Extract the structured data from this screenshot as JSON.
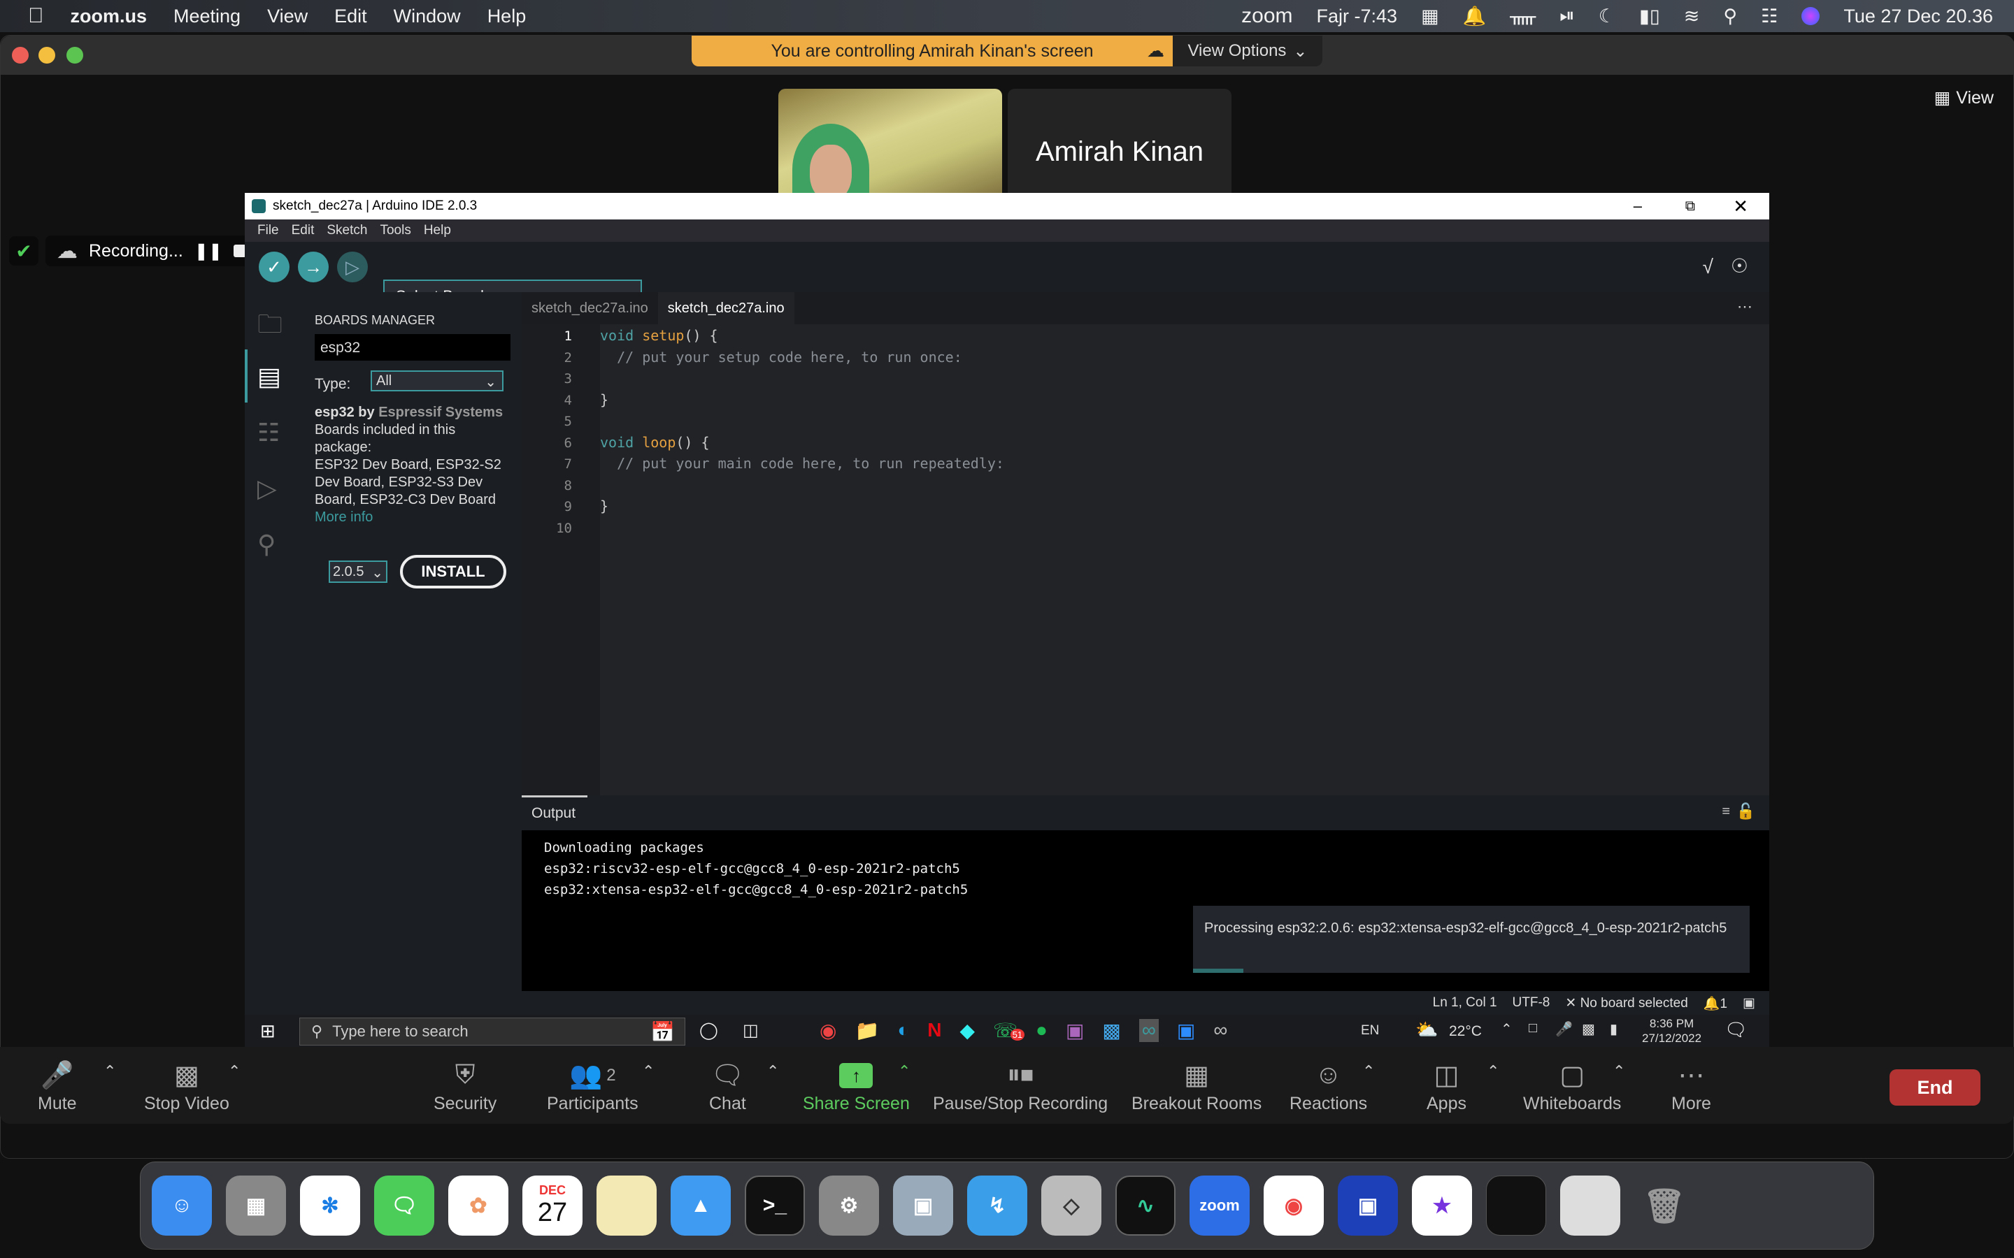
{
  "menubar": {
    "app": "zoom.us",
    "items": [
      "Meeting",
      "View",
      "Edit",
      "Window",
      "Help"
    ],
    "status": {
      "zoom": "zoom",
      "prayer": "Fajr -7:43",
      "datetime": "Tue 27 Dec  20.36"
    }
  },
  "zoom": {
    "banner": "You are controlling Amirah Kinan's screen",
    "view_options": "View Options",
    "view": "View",
    "participant_name": "Amirah Kinan",
    "recording": "Recording...",
    "toolbar": {
      "mute": "Mute",
      "stop_video": "Stop Video",
      "security": "Security",
      "participants": "Participants",
      "participants_count": "2",
      "chat": "Chat",
      "share_screen": "Share Screen",
      "recording": "Pause/Stop Recording",
      "breakout": "Breakout Rooms",
      "reactions": "Reactions",
      "apps": "Apps",
      "whiteboards": "Whiteboards",
      "more": "More",
      "end": "End"
    },
    "accent": "#5dcc5f",
    "end_color": "#b33232"
  },
  "ide": {
    "title": "sketch_dec27a | Arduino IDE 2.0.3",
    "menu": [
      "File",
      "Edit",
      "Sketch",
      "Tools",
      "Help"
    ],
    "board_select": "Select Board",
    "accent": "#3c9b9e",
    "boards_manager": {
      "heading": "BOARDS MANAGER",
      "search": "esp32",
      "type_label": "Type:",
      "type_value": "All",
      "pkg_name": "esp32",
      "pkg_by": "by",
      "pkg_author": "Espressif Systems",
      "pkg_desc_label": "Boards included in this package:",
      "pkg_boards": "ESP32 Dev Board, ESP32-S2 Dev Board, ESP32-S3 Dev Board, ESP32-C3 Dev Board",
      "more_info": "More info",
      "version": "2.0.5",
      "install": "INSTALL"
    },
    "tabs": [
      "sketch_dec27a.ino",
      "sketch_dec27a.ino"
    ],
    "code": [
      {
        "n": "1",
        "parts": [
          [
            "kw",
            "void "
          ],
          [
            "fn",
            "setup"
          ],
          [
            "",
            "() {"
          ]
        ]
      },
      {
        "n": "2",
        "parts": [
          [
            "cm",
            "  // put your setup code here, to run once:"
          ]
        ]
      },
      {
        "n": "3",
        "parts": []
      },
      {
        "n": "4",
        "parts": [
          [
            "",
            "}"
          ]
        ]
      },
      {
        "n": "5",
        "parts": []
      },
      {
        "n": "6",
        "parts": [
          [
            "kw",
            "void "
          ],
          [
            "fn",
            "loop"
          ],
          [
            "",
            "() {"
          ]
        ]
      },
      {
        "n": "7",
        "parts": [
          [
            "cm",
            "  // put your main code here, to run repeatedly:"
          ]
        ]
      },
      {
        "n": "8",
        "parts": []
      },
      {
        "n": "9",
        "parts": [
          [
            "",
            "}"
          ]
        ]
      },
      {
        "n": "10",
        "parts": []
      }
    ],
    "output": {
      "label": "Output",
      "lines": [
        "Downloading packages",
        "esp32:riscv32-esp-elf-gcc@gcc8_4_0-esp-2021r2-patch5",
        "esp32:xtensa-esp32-elf-gcc@gcc8_4_0-esp-2021r2-patch5"
      ],
      "toast": "Processing esp32:2.0.6: esp32:xtensa-esp32-elf-gcc@gcc8_4_0-esp-2021r2-patch5",
      "toast_progress": 0.09
    },
    "status": {
      "pos": "Ln 1, Col 1",
      "enc": "UTF-8",
      "board": "No board selected",
      "notif": "1"
    }
  },
  "windows_taskbar": {
    "search_placeholder": "Type here to search",
    "lang": "EN",
    "temp": "22°C",
    "time": "8:36 PM",
    "date": "27/12/2022",
    "whatsapp_badge": "51"
  },
  "dock": {
    "calendar_month": "DEC",
    "calendar_day": "27",
    "zoom_label": "zoom"
  }
}
